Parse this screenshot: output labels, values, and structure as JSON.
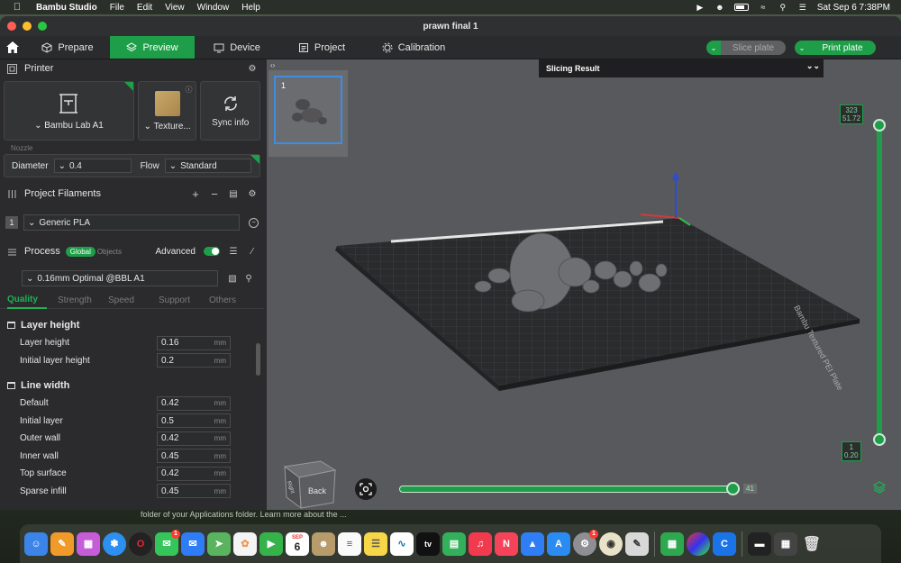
{
  "menubar": {
    "app_name": "Bambu Studio",
    "menus": [
      "File",
      "Edit",
      "View",
      "Window",
      "Help"
    ],
    "clock": "Sat Sep 6  7:38PM"
  },
  "window": {
    "title": "prawn final 1",
    "tabs": [
      {
        "label": "Prepare",
        "icon": "cube-icon"
      },
      {
        "label": "Preview",
        "icon": "layers-icon"
      },
      {
        "label": "Device",
        "icon": "device-icon"
      },
      {
        "label": "Project",
        "icon": "project-icon"
      },
      {
        "label": "Calibration",
        "icon": "calibration-icon"
      }
    ],
    "slice_label": "Slice plate",
    "print_label": "Print plate"
  },
  "printer": {
    "section_title": "Printer",
    "printer_name": "Bambu Lab A1",
    "plate_name": "Texture...",
    "sync_label": "Sync info",
    "nozzle_label": "Nozzle",
    "diameter_label": "Diameter",
    "diameter_value": "0.4",
    "flow_label": "Flow",
    "flow_value": "Standard"
  },
  "filaments": {
    "section_title": "Project Filaments",
    "items": [
      {
        "slot": "1",
        "name": "Generic PLA"
      }
    ]
  },
  "process": {
    "section_title": "Process",
    "global_label": "Global",
    "objects_label": "Objects",
    "advanced_label": "Advanced",
    "preset": "0.16mm Optimal @BBL A1",
    "subtabs": [
      "Quality",
      "Strength",
      "Speed",
      "Support",
      "Others"
    ],
    "groups": [
      {
        "title": "Layer height",
        "rows": [
          {
            "name": "Layer height",
            "value": "0.16",
            "unit": "mm"
          },
          {
            "name": "Initial layer height",
            "value": "0.2",
            "unit": "mm"
          }
        ]
      },
      {
        "title": "Line width",
        "rows": [
          {
            "name": "Default",
            "value": "0.42",
            "unit": "mm"
          },
          {
            "name": "Initial layer",
            "value": "0.5",
            "unit": "mm"
          },
          {
            "name": "Outer wall",
            "value": "0.42",
            "unit": "mm"
          },
          {
            "name": "Inner wall",
            "value": "0.45",
            "unit": "mm"
          },
          {
            "name": "Top surface",
            "value": "0.42",
            "unit": "mm"
          },
          {
            "name": "Sparse infill",
            "value": "0.45",
            "unit": "mm"
          }
        ]
      }
    ]
  },
  "viewport": {
    "plate_number": "1",
    "slicing_result_label": "Slicing Result",
    "layer_top": "323",
    "height_top": "51.72",
    "layer_bottom": "1",
    "height_bottom": "0.20",
    "move_value": "41",
    "cube_label": "Back",
    "cube_side_label": "Right",
    "bed_label": "Bambu Textured PEI Plate"
  },
  "notification": "folder of your Applications folder. Learn more about the ...",
  "dock": {
    "calendar_month": "SEP",
    "calendar_day": "6",
    "tv_label": "tv",
    "messages_badge": "1",
    "settings_badge": "1"
  },
  "colors": {
    "accent": "#1e9e49",
    "viewport_bg": "#58595c",
    "panel_bg": "#2b2b2d"
  }
}
